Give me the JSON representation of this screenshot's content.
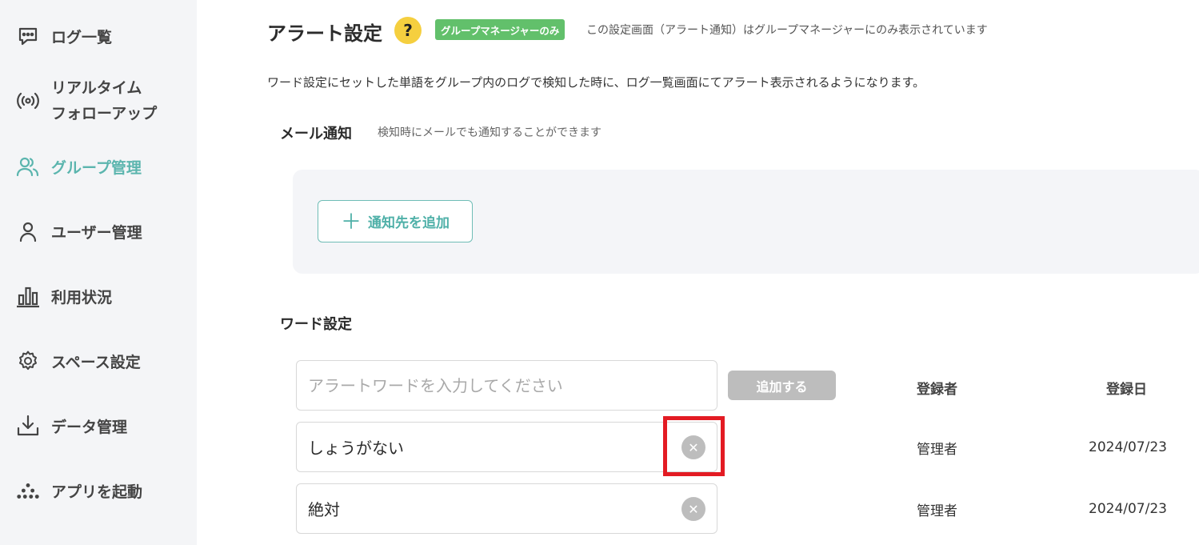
{
  "sidebar": {
    "items": [
      {
        "label": "ログ一覧",
        "icon": "chat-bubble-icon"
      },
      {
        "label_line1": "リアルタイム",
        "label_line2": "フォローアップ",
        "icon": "broadcast-icon"
      },
      {
        "label": "グループ管理",
        "icon": "group-users-icon",
        "active": true
      },
      {
        "label": "ユーザー管理",
        "icon": "user-icon"
      },
      {
        "label": "利用状況",
        "icon": "bar-chart-icon"
      },
      {
        "label": "スペース設定",
        "icon": "gear-icon"
      },
      {
        "label": "データ管理",
        "icon": "download-icon"
      },
      {
        "label": "アプリを起動",
        "icon": "app-launch-icon"
      }
    ],
    "active_color": "#5bb5ae"
  },
  "header": {
    "title": "アラート設定",
    "help": "?",
    "role_tag": "グループマネージャーのみ",
    "role_note": "この設定画面（アラート通知）はグループマネージャーにのみ表示されています"
  },
  "description": "ワード設定にセットした単語をグループ内のログで検知した時に、ログ一覧画面にてアラート表示されるようになります。",
  "mail": {
    "title": "メール通知",
    "note": "検知時にメールでも通知することができます",
    "add_button": "通知先を追加",
    "add_icon": "＋"
  },
  "words": {
    "title": "ワード設定",
    "input_placeholder": "アラートワードを入力してください",
    "input_value": "",
    "add_button": "追加する",
    "col_registrant": "登録者",
    "col_date": "登録日",
    "rows": [
      {
        "word": "しょうがない",
        "registrant": "管理者",
        "date": "2024/07/23"
      },
      {
        "word": "絶対",
        "registrant": "管理者",
        "date": "2024/07/23"
      }
    ]
  },
  "clear_glyph": "✕"
}
